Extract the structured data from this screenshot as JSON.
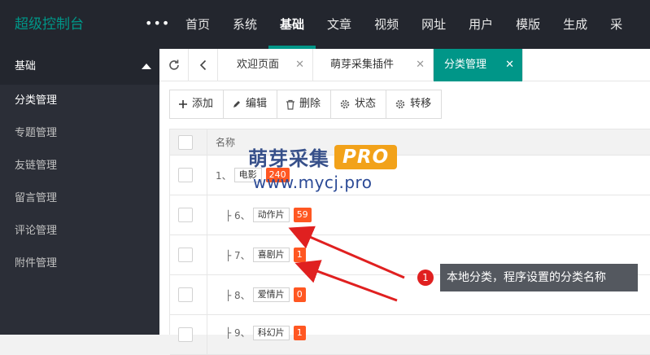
{
  "app": {
    "title": "超级控制台",
    "more": "•••"
  },
  "nav": [
    "首页",
    "系统",
    "基础",
    "文章",
    "视频",
    "网址",
    "用户",
    "模版",
    "生成",
    "采"
  ],
  "sidebar": {
    "section": "基础",
    "items": [
      "分类管理",
      "专题管理",
      "友链管理",
      "留言管理",
      "评论管理",
      "附件管理"
    ]
  },
  "tabs": [
    "欢迎页面",
    "萌芽采集插件",
    "分类管理"
  ],
  "toolbar": {
    "add": "添加",
    "edit": "编辑",
    "delete": "删除",
    "status": "状态",
    "move": "转移"
  },
  "table": {
    "header": "名称",
    "rows": [
      {
        "prefix": "1、",
        "name": "电影",
        "count": "240"
      },
      {
        "prefix": "├ 6、",
        "name": "动作片",
        "count": "59"
      },
      {
        "prefix": "├ 7、",
        "name": "喜剧片",
        "count": "1"
      },
      {
        "prefix": "├ 8、",
        "name": "爱情片",
        "count": "0"
      },
      {
        "prefix": "├ 9、",
        "name": "科幻片",
        "count": "1"
      }
    ]
  },
  "watermark": {
    "title": "萌芽采集",
    "badge": "PRO",
    "url": "www.mycj.pro"
  },
  "annotation": {
    "number": "1",
    "text": "本地分类，程序设置的分类名称"
  },
  "colors": {
    "accent": "#009688",
    "topbar": "#23262e",
    "sidebar": "#2b2e37",
    "badge": "#ff5722",
    "marker": "#e02020"
  }
}
